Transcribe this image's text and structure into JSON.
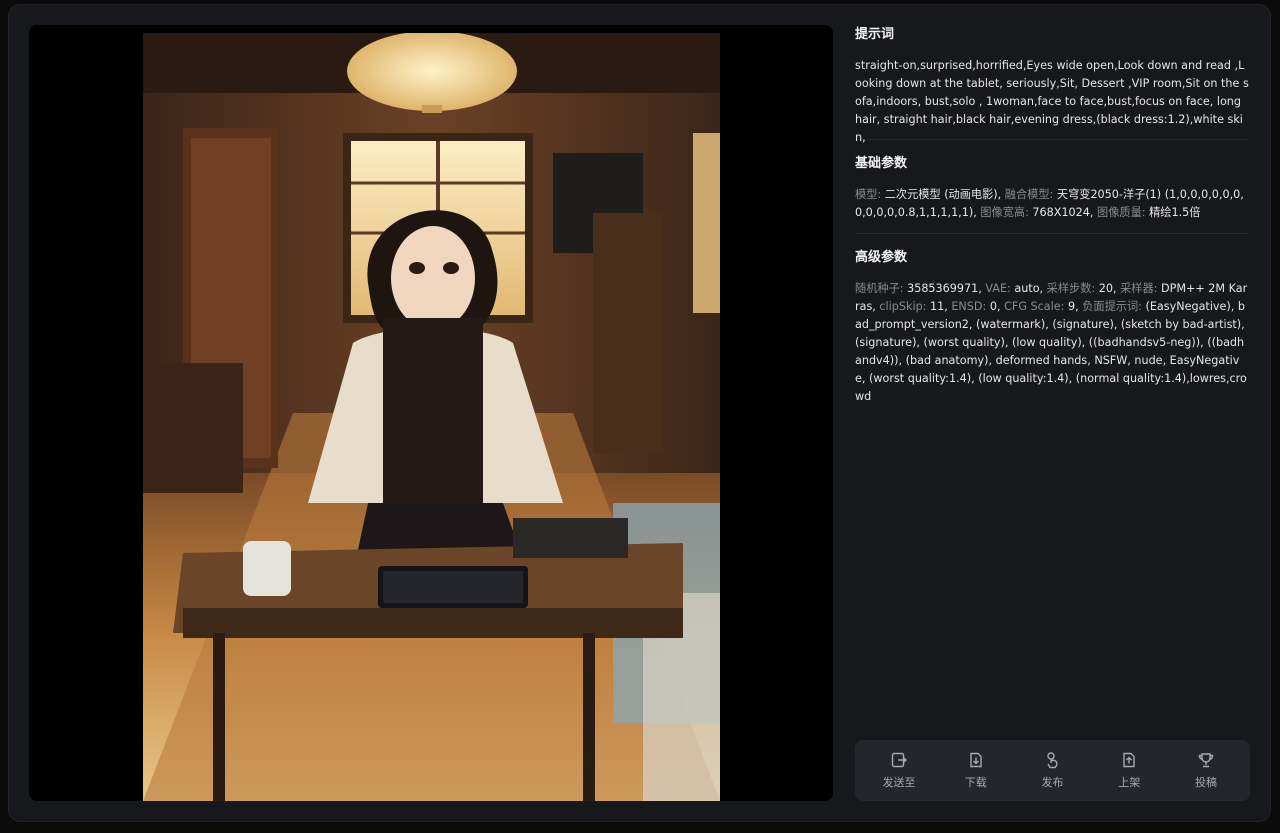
{
  "prompt_section": {
    "title": "提示词",
    "text": "straight-on,surprised,horrified,Eyes wide open,Look down and read ,Looking down at the tablet, seriously,Sit, Dessert ,VIP room,Sit on the sofa,indoors, bust,solo , 1woman,face to face,bust,focus on face, long hair, straight hair,black hair,evening dress,(black dress:1.2),white skin,"
  },
  "basic_params": {
    "title": "基础参数",
    "items": [
      {
        "key": "模型: ",
        "value": "二次元模型 (动画电影), "
      },
      {
        "key": "融合模型: ",
        "value": "天穹变2050-洋子(1) (1,0,0,0,0,0,0,0,0,0,0,0.8,1,1,1,1,1), "
      },
      {
        "key": "图像宽高: ",
        "value": "768X1024, "
      },
      {
        "key": "图像质量: ",
        "value": "精绘1.5倍"
      }
    ]
  },
  "advanced_params": {
    "title": "高级参数",
    "items": [
      {
        "key": "随机种子: ",
        "value": "3585369971, "
      },
      {
        "key": "VAE: ",
        "value": "auto, "
      },
      {
        "key": "采样步数: ",
        "value": "20, "
      },
      {
        "key": "采样器: ",
        "value": "DPM++ 2M Karras, "
      },
      {
        "key": "clipSkip: ",
        "value": "11, "
      },
      {
        "key": "ENSD: ",
        "value": "0, "
      },
      {
        "key": "CFG Scale: ",
        "value": "9, "
      },
      {
        "key": "负面提示词: ",
        "value": "(EasyNegative), bad_prompt_version2, (watermark), (signature), (sketch by bad-artist), (signature), (worst quality), (low quality), ((badhandsv5-neg)), ((badhandv4)), (bad anatomy), deformed hands, NSFW, nude, EasyNegative, (worst quality:1.4), (low quality:1.4), (normal quality:1.4),lowres,crowd"
      }
    ]
  },
  "toolbar": {
    "send_to": "发送至",
    "download": "下载",
    "publish": "发布",
    "list": "上架",
    "submit": "投稿"
  }
}
